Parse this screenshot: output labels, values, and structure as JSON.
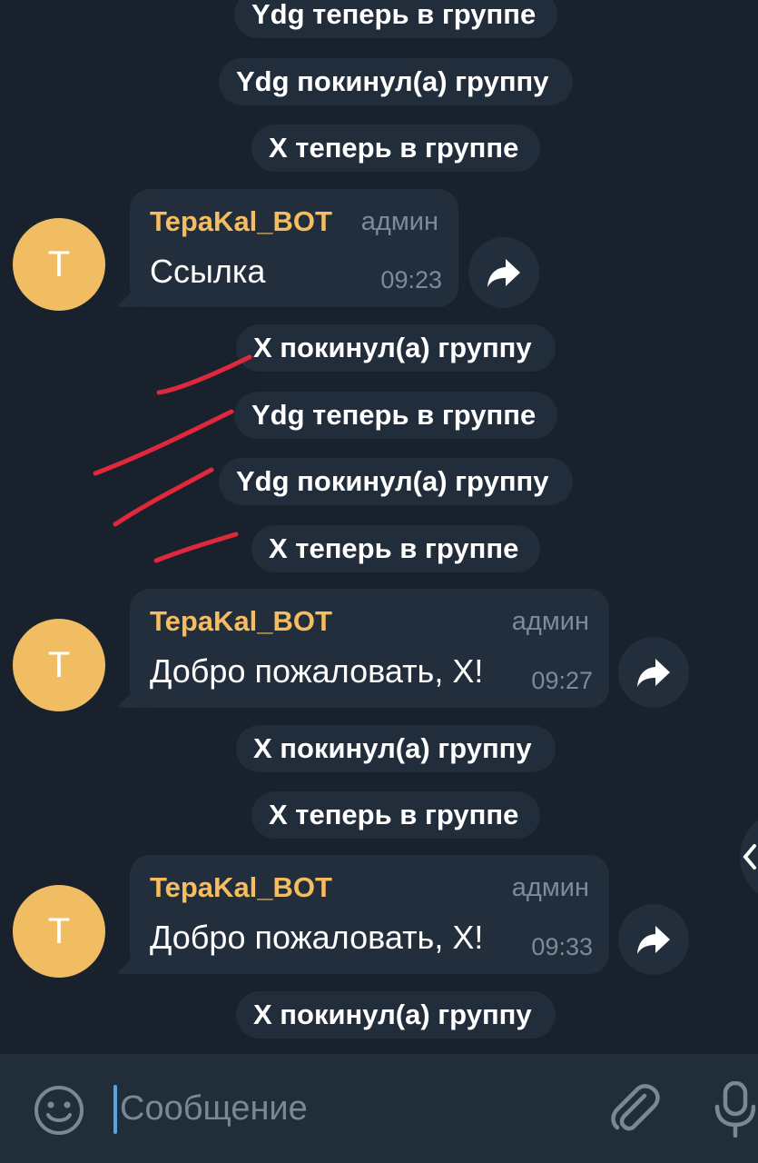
{
  "service_messages": [
    "Ydg теперь в группе",
    "Ydg покинул(а) группу",
    "X теперь в группе",
    "X покинул(а) группу",
    "Ydg теперь в группе",
    "Ydg покинул(а) группу",
    "X теперь в группе",
    "X покинул(а) группу",
    "X теперь в группе",
    "X покинул(а) группу"
  ],
  "messages": [
    {
      "avatar_letter": "T",
      "sender": "TepaKal_BOT",
      "role": "админ",
      "text": "Ссылка",
      "time": "09:23"
    },
    {
      "avatar_letter": "T",
      "sender": "TepaKal_BOT",
      "role": "админ",
      "text": "Добро пожаловать, X!",
      "time": "09:27"
    },
    {
      "avatar_letter": "T",
      "sender": "TepaKal_BOT",
      "role": "админ",
      "text": "Добро пожаловать, X!",
      "time": "09:33"
    }
  ],
  "composer": {
    "placeholder": "Сообщение"
  },
  "icons": {
    "emoji": "smile-icon",
    "attach": "paperclip-icon",
    "mic": "microphone-icon",
    "forward": "share-arrow-icon"
  },
  "colors": {
    "background": "#18212c",
    "bubble": "#232e3c",
    "avatar": "#f0bd63",
    "sender": "#f5bd60",
    "annotation": "#e0283c",
    "cursor": "#5aa2e6"
  }
}
